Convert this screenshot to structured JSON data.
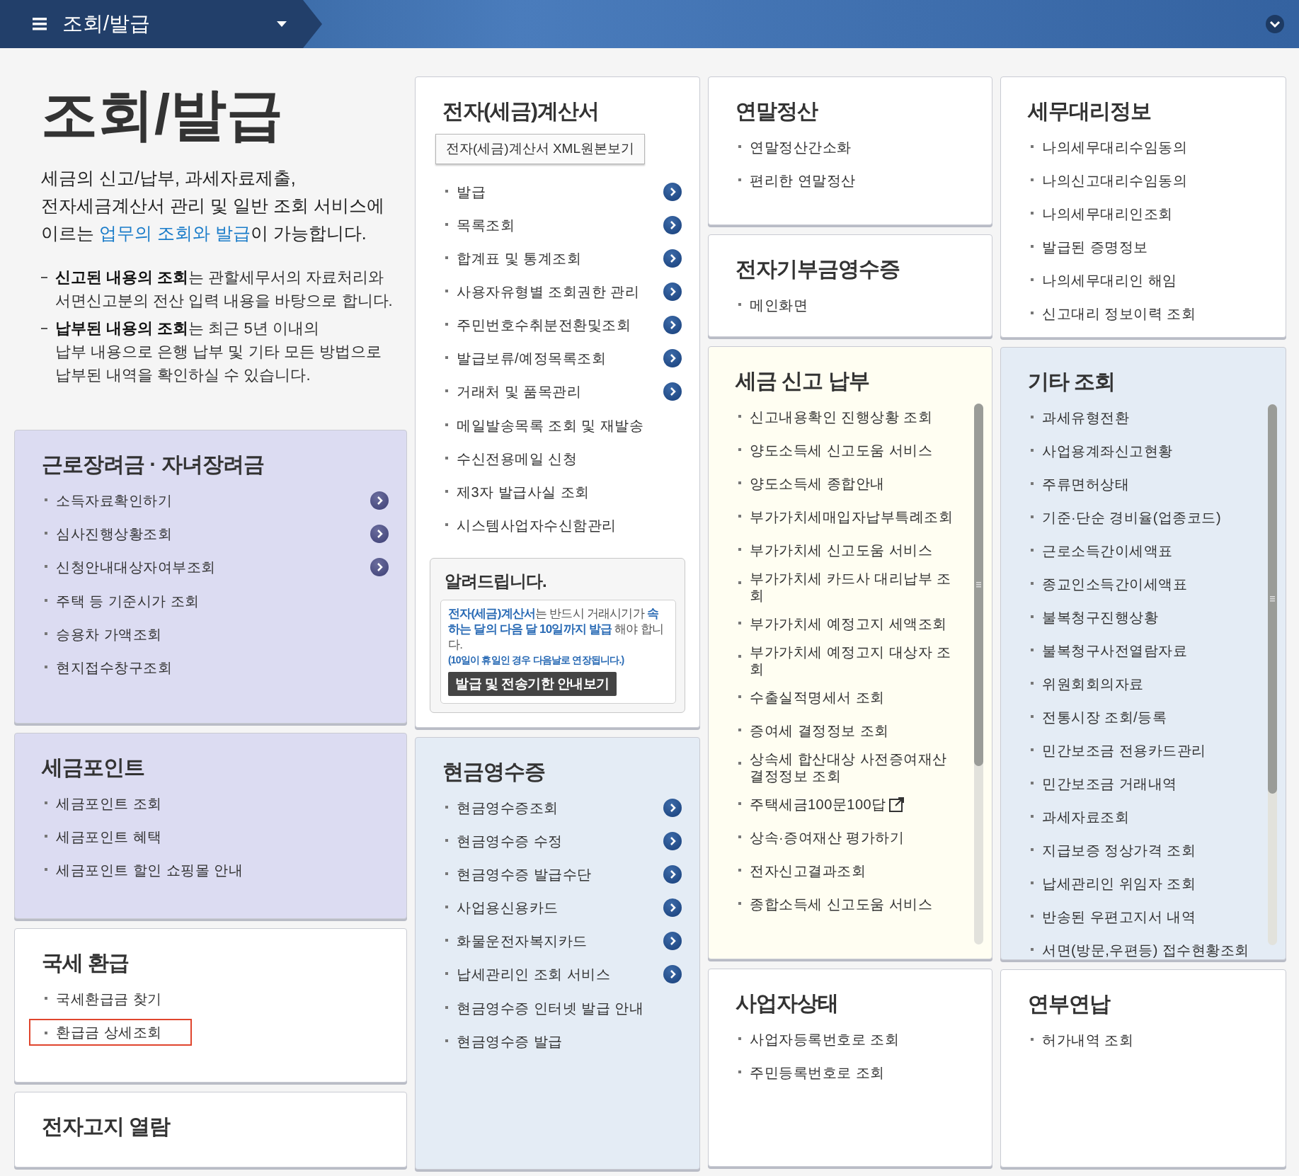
{
  "top_bar": {
    "title": "조회/발급"
  },
  "intro": {
    "heading": "조회/발급",
    "description_before": "세금의 신고/납부, 과세자료제출,\n전자세금계산서 관리 및 일반 조회 서비스에\n이르는 ",
    "description_link": "업무의 조회와 발급",
    "description_after": "이 가능합니다.",
    "notes": [
      "**신고된 내용의 조회**는 관할세무서의 자료처리와\n서면신고분의 전산 입력 내용을 바탕으로 합니다.",
      "**납부된 내용의 조회**는 최근 5년 이내의\n납부 내용으로 은행 납부 및 기타 모든 방법으로\n납부된 내역을 확인하실 수 있습니다."
    ]
  },
  "columns": [
    {
      "cards": [
        {
          "title": "근로장려금 · 자녀장려금",
          "color": "#dcdcf2",
          "items": [
            {
              "label": "소득자료확인하기",
              "arrow": true
            },
            {
              "label": "심사진행상황조회",
              "arrow": true
            },
            {
              "label": "신청안내대상자여부조회",
              "arrow": true
            },
            {
              "label": "주택 등 기준시가 조회",
              "arrow": false
            },
            {
              "label": "승용차 가액조회",
              "arrow": false
            },
            {
              "label": "현지접수창구조회",
              "arrow": false
            }
          ]
        },
        {
          "title": "세금포인트",
          "color": "#dcdcf2",
          "items": [
            {
              "label": "세금포인트 조회"
            },
            {
              "label": "세금포인트 혜택"
            },
            {
              "label": "세금포인트 할인 쇼핑몰 안내"
            }
          ]
        },
        {
          "title": "국세 환급",
          "color": "#ffffff",
          "items": [
            {
              "label": "국세환급금 찾기",
              "highlighted": false
            },
            {
              "label": "환급금 상세조회",
              "highlighted": true
            }
          ]
        },
        {
          "title": "전자고지 열람",
          "color": "#ffffff"
        }
      ]
    },
    {
      "cards": [
        {
          "title": "전자(세금)계산서",
          "color": "#ffffff",
          "button": "전자(세금)계산서 XML원본보기",
          "items": [
            {
              "label": "발급",
              "arrow": true
            },
            {
              "label": "목록조회",
              "arrow": true
            },
            {
              "label": "합계표 및 통계조회",
              "arrow": true
            },
            {
              "label": "사용자유형별 조회권한 관리",
              "arrow": true
            },
            {
              "label": "주민번호수취분전환및조회",
              "arrow": true
            },
            {
              "label": "발급보류/예정목록조회",
              "arrow": true
            },
            {
              "label": "거래처 및 품목관리",
              "arrow": true
            },
            {
              "label": "메일발송목록 조회 및 재발송",
              "arrow": false
            },
            {
              "label": "수신전용메일 신청",
              "arrow": false
            },
            {
              "label": "제3자 발급사실 조회",
              "arrow": false
            },
            {
              "label": "시스템사업자수신함관리",
              "arrow": false
            }
          ],
          "notice": {
            "title": "알려드립니다.",
            "text": "**전자(세금)계산서**는 반드시 거래시기가 **속하는 달의 다음 달 10일까지 발급** 해야 합니다.",
            "note": "(10일이 휴일인 경우 다음날로 연장됩니다.)",
            "button": "발급 및 전송기한 안내보기"
          }
        },
        {
          "title": "현금영수증",
          "color": "#e4ecf5",
          "items": [
            {
              "label": "현금영수증조회",
              "arrow": true
            },
            {
              "label": "현금영수증 수정",
              "arrow": true
            },
            {
              "label": "현금영수증 발급수단",
              "arrow": true
            },
            {
              "label": "사업용신용카드",
              "arrow": true
            },
            {
              "label": "화물운전자복지카드",
              "arrow": true
            },
            {
              "label": "납세관리인 조회 서비스",
              "arrow": true
            },
            {
              "label": "현금영수증 인터넷 발급 안내",
              "arrow": false
            },
            {
              "label": "현금영수증 발급",
              "arrow": false
            }
          ]
        }
      ]
    },
    {
      "cards": [
        {
          "title": "연말정산",
          "color": "#ffffff",
          "items": [
            {
              "label": "연말정산간소화"
            },
            {
              "label": "편리한 연말정산"
            }
          ]
        },
        {
          "title": "전자기부금영수증",
          "color": "#ffffff",
          "items": [
            {
              "label": "메인화면"
            }
          ]
        },
        {
          "title": "세금 신고 납부",
          "color": "#fffef2",
          "scrollable": true,
          "items": [
            {
              "label": "신고내용확인 진행상황 조회",
              "external": false
            },
            {
              "label": "양도소득세 신고도움 서비스",
              "external": false
            },
            {
              "label": "양도소득세 종합안내",
              "external": false
            },
            {
              "label": "부가가치세매입자납부특례조회",
              "external": false
            },
            {
              "label": "부가가치세 신고도움 서비스",
              "external": false
            },
            {
              "label": "부가가치세 카드사 대리납부 조회",
              "external": false
            },
            {
              "label": "부가가치세 예정고지 세액조회",
              "external": false
            },
            {
              "label": "부가가치세 예정고지 대상자 조회",
              "external": false
            },
            {
              "label": "수출실적명세서 조회",
              "external": false
            },
            {
              "label": "증여세 결정정보 조회",
              "external": false
            },
            {
              "label": "상속세 합산대상 사전증여재산 결정정보 조회",
              "external": false
            },
            {
              "label": "주택세금100문100답",
              "external": true
            },
            {
              "label": "상속·증여재산 평가하기",
              "external": false
            },
            {
              "label": "전자신고결과조회",
              "external": false
            },
            {
              "label": "종합소득세 신고도움 서비스",
              "external": false
            }
          ]
        },
        {
          "title": "사업자상태",
          "color": "#ffffff",
          "items": [
            {
              "label": "사업자등록번호로 조회"
            },
            {
              "label": "주민등록번호로 조회"
            }
          ]
        }
      ]
    },
    {
      "cards": [
        {
          "title": "세무대리정보",
          "color": "#ffffff",
          "items": [
            {
              "label": "나의세무대리수임동의"
            },
            {
              "label": "나의신고대리수임동의"
            },
            {
              "label": "나의세무대리인조회"
            },
            {
              "label": "발급된 증명정보"
            },
            {
              "label": "나의세무대리인 해임"
            },
            {
              "label": "신고대리 정보이력 조회"
            }
          ]
        },
        {
          "title": "기타 조회",
          "color": "#e4ecf5",
          "scrollable": true,
          "items": [
            {
              "label": "과세유형전환"
            },
            {
              "label": "사업용계좌신고현황"
            },
            {
              "label": "주류면허상태"
            },
            {
              "label": "기준·단순 경비율(업종코드)"
            },
            {
              "label": "근로소득간이세액표"
            },
            {
              "label": "종교인소득간이세액표"
            },
            {
              "label": "불복청구진행상황"
            },
            {
              "label": "불복청구사전열람자료"
            },
            {
              "label": "위원회회의자료"
            },
            {
              "label": "전통시장 조회/등록"
            },
            {
              "label": "민간보조금 전용카드관리"
            },
            {
              "label": "민간보조금 거래내역"
            },
            {
              "label": "과세자료조회"
            },
            {
              "label": "지급보증 정상가격 조회"
            },
            {
              "label": "납세관리인 위임자 조회"
            },
            {
              "label": "반송된 우편고지서 내역"
            },
            {
              "label": "서면(방문,우편등) 접수현황조회"
            }
          ]
        },
        {
          "title": "연부연납",
          "color": "#ffffff",
          "items": [
            {
              "label": "허가내역 조회"
            }
          ]
        }
      ]
    }
  ]
}
